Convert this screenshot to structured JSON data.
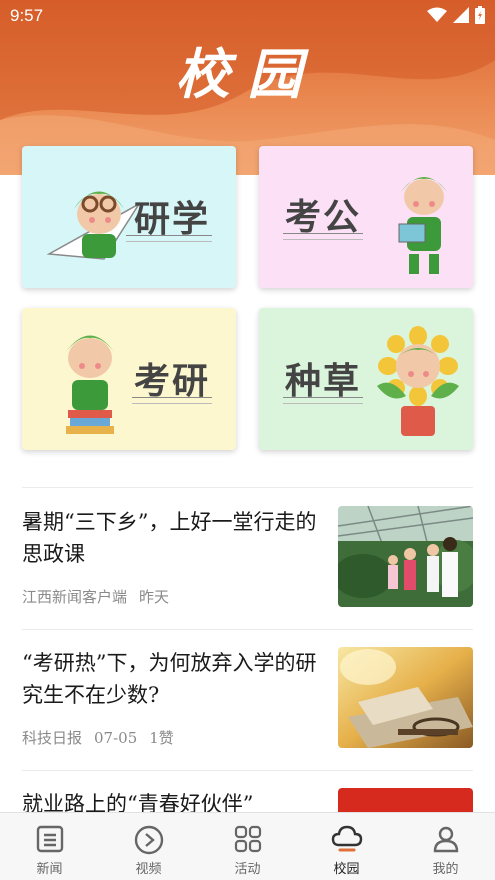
{
  "status_bar": {
    "time": "9:57"
  },
  "page": {
    "title": "校园"
  },
  "categories": [
    {
      "label": "研学",
      "bg": "#d7f6f7"
    },
    {
      "label": "考公",
      "bg": "#fbe0f6"
    },
    {
      "label": "考研",
      "bg": "#fdf7d0"
    },
    {
      "label": "种草",
      "bg": "#dbf5dd"
    }
  ],
  "news": [
    {
      "title": "暑期“三下乡”，上好一堂行走的思政课",
      "source": "江西新闻客户端",
      "time": "昨天",
      "likes": ""
    },
    {
      "title": "“考研热”下，为何放弃入学的研究生不在少数?",
      "source": "科技日报",
      "time": "07-05",
      "likes": "1赞"
    },
    {
      "title": "就业路上的“青春好伙伴”",
      "source": "",
      "time": "",
      "likes": ""
    }
  ],
  "tabbar": {
    "items": [
      {
        "label": "新闻",
        "icon": "news-icon"
      },
      {
        "label": "视频",
        "icon": "video-icon"
      },
      {
        "label": "活动",
        "icon": "activity-icon"
      },
      {
        "label": "校园",
        "icon": "campus-icon",
        "active": true
      },
      {
        "label": "我的",
        "icon": "profile-icon"
      }
    ]
  },
  "colors": {
    "brand": "#e0703a",
    "active_tab": "#222222"
  }
}
